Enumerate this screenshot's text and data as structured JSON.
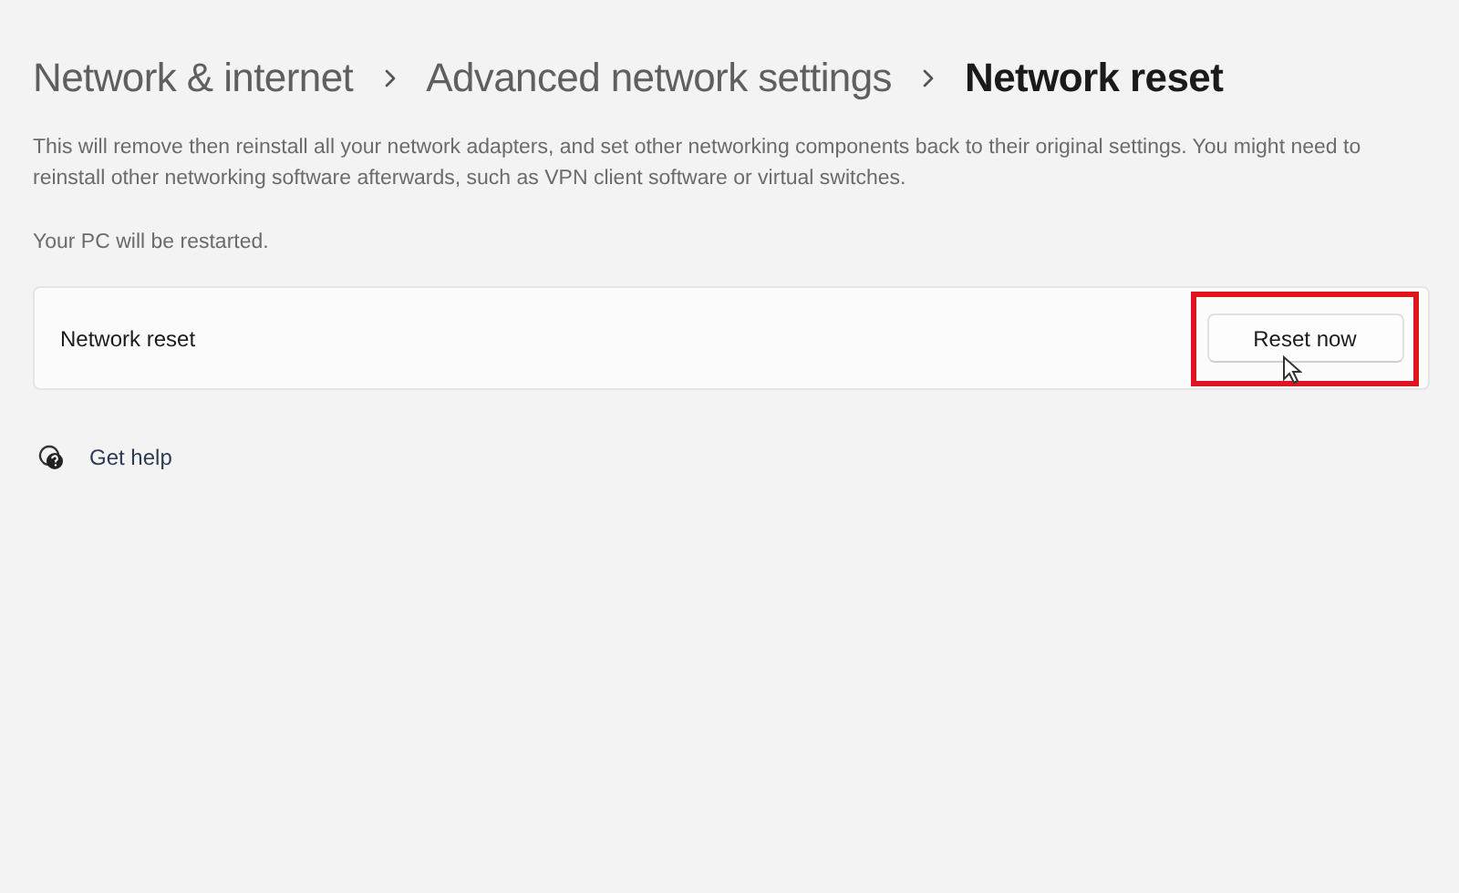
{
  "breadcrumb": [
    {
      "label": "Network & internet",
      "current": false
    },
    {
      "label": "Advanced network settings",
      "current": false
    },
    {
      "label": "Network reset",
      "current": true
    }
  ],
  "description": "This will remove then reinstall all your network adapters, and set other networking components back to their original settings. You might need to reinstall other networking software afterwards, such as VPN client software or virtual switches.",
  "note": "Your PC will be restarted.",
  "card": {
    "label": "Network reset",
    "button": "Reset now",
    "highlighted": true
  },
  "help_link": "Get help"
}
